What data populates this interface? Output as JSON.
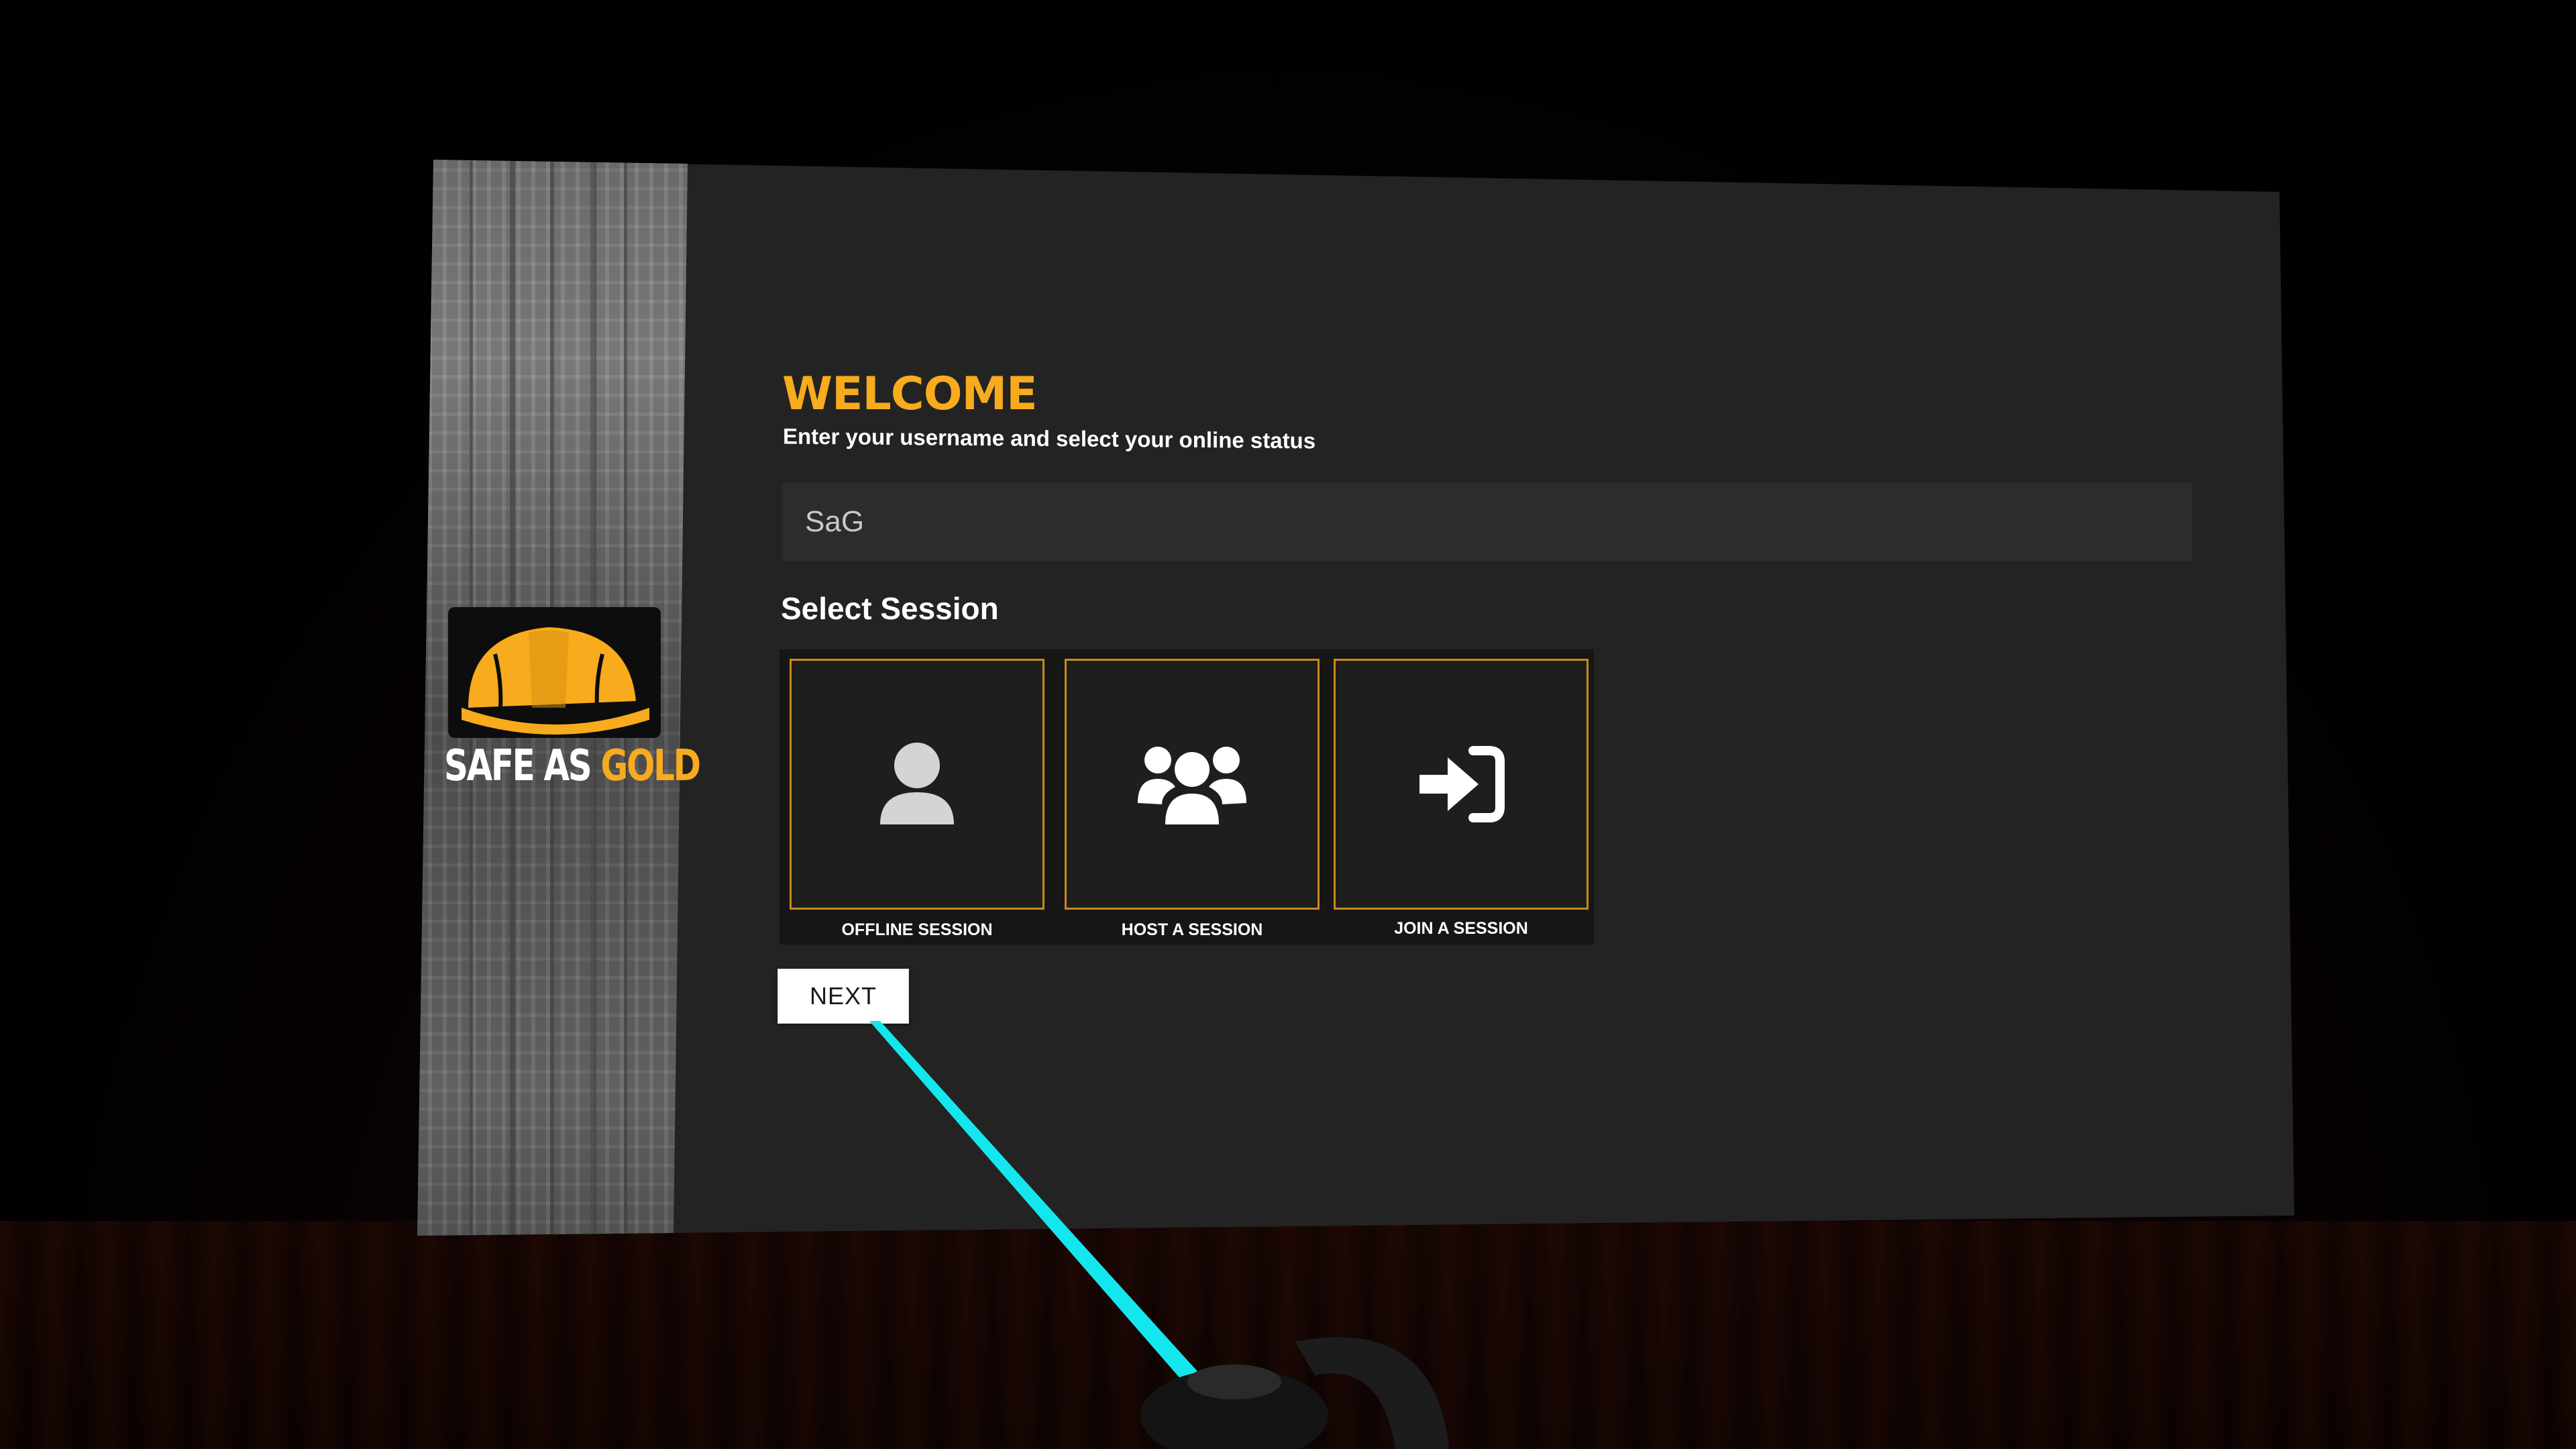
{
  "welcome": {
    "title": "WELCOME",
    "subtitle": "Enter your username and select your online status"
  },
  "username": {
    "value": "SaG"
  },
  "session": {
    "heading": "Select Session",
    "options": [
      {
        "label": "OFFLINE SESSION",
        "icon": "single-user-icon"
      },
      {
        "label": "HOST A SESSION",
        "icon": "user-group-icon"
      },
      {
        "label": "JOIN A SESSION",
        "icon": "sign-in-icon"
      }
    ]
  },
  "next_button": {
    "label": "NEXT"
  },
  "brand": {
    "name_part1": "SAFE AS",
    "name_part2": "GOLD",
    "logo_icon": "hard-hat-icon"
  },
  "colors": {
    "accent": "#f7ab1d",
    "panel": "#232323",
    "card_border": "#c98a18",
    "laser": "#14e6ee"
  }
}
